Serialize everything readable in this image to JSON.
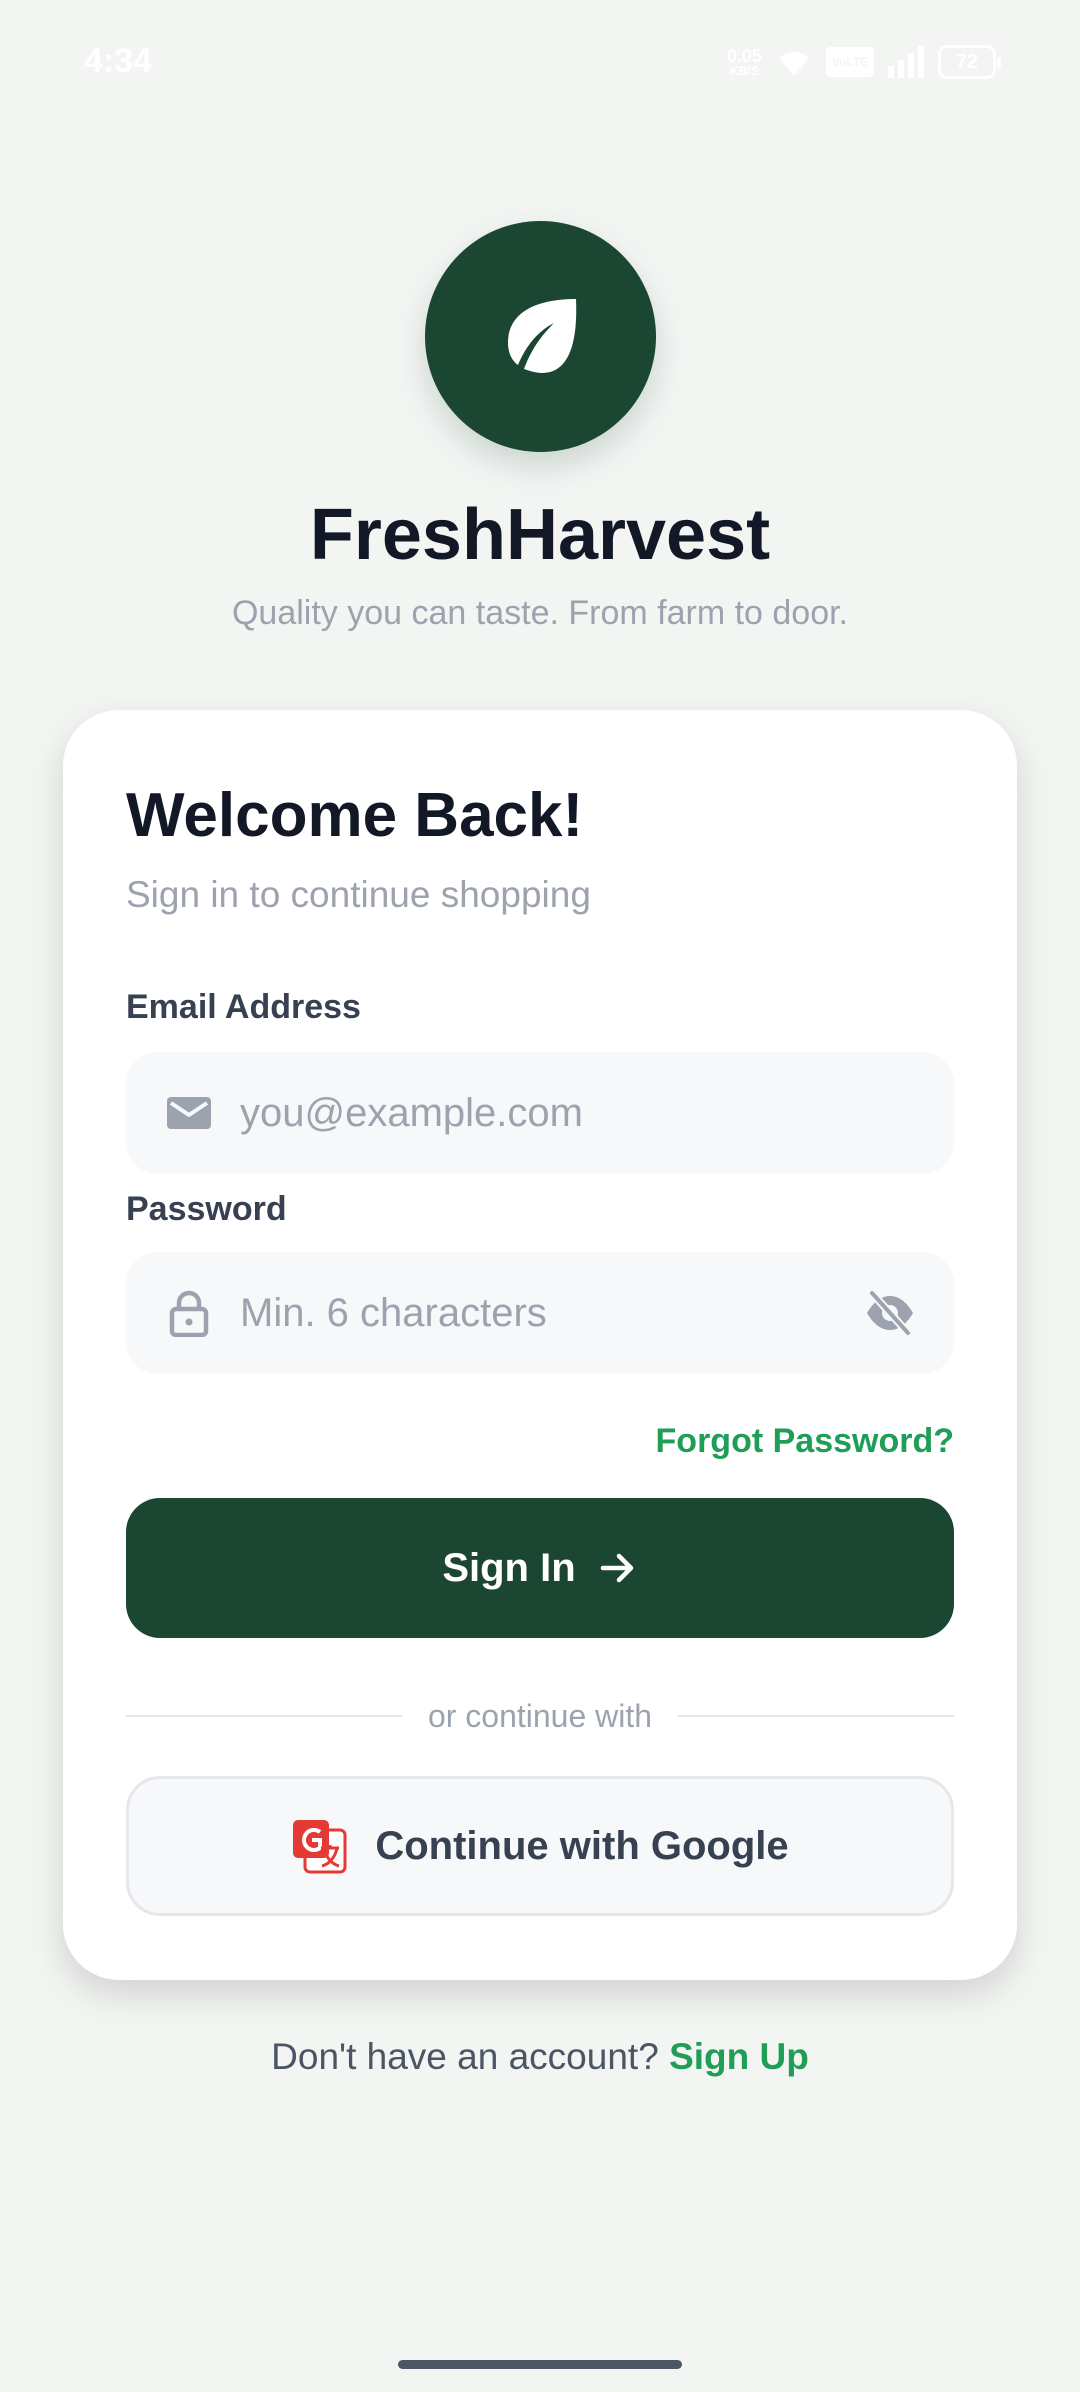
{
  "status_bar": {
    "time": "4:34",
    "net_speed_value": "0.05",
    "net_speed_unit": "KB/S",
    "volte": "VoLTE",
    "battery": "72"
  },
  "brand": {
    "logo_icon": "leaf-icon",
    "name": "FreshHarvest",
    "tagline": "Quality you can taste. From farm to door.",
    "primary_color": "#1b4632",
    "accent_color": "#1e9e57"
  },
  "login": {
    "title": "Welcome Back!",
    "subtitle": "Sign in to continue shopping",
    "email": {
      "label": "Email Address",
      "value": "",
      "placeholder": "you@example.com",
      "icon": "mail-icon"
    },
    "password": {
      "label": "Password",
      "value": "",
      "placeholder": "Min. 6 characters",
      "icon": "lock-icon",
      "toggle_icon": "eye-off-icon"
    },
    "forgot_password": "Forgot Password?",
    "sign_in_button": "Sign In",
    "divider_text": "or continue with",
    "google_button": "Continue with Google"
  },
  "footer": {
    "prompt": "Don't have an account?",
    "sign_up_link": "Sign Up"
  }
}
